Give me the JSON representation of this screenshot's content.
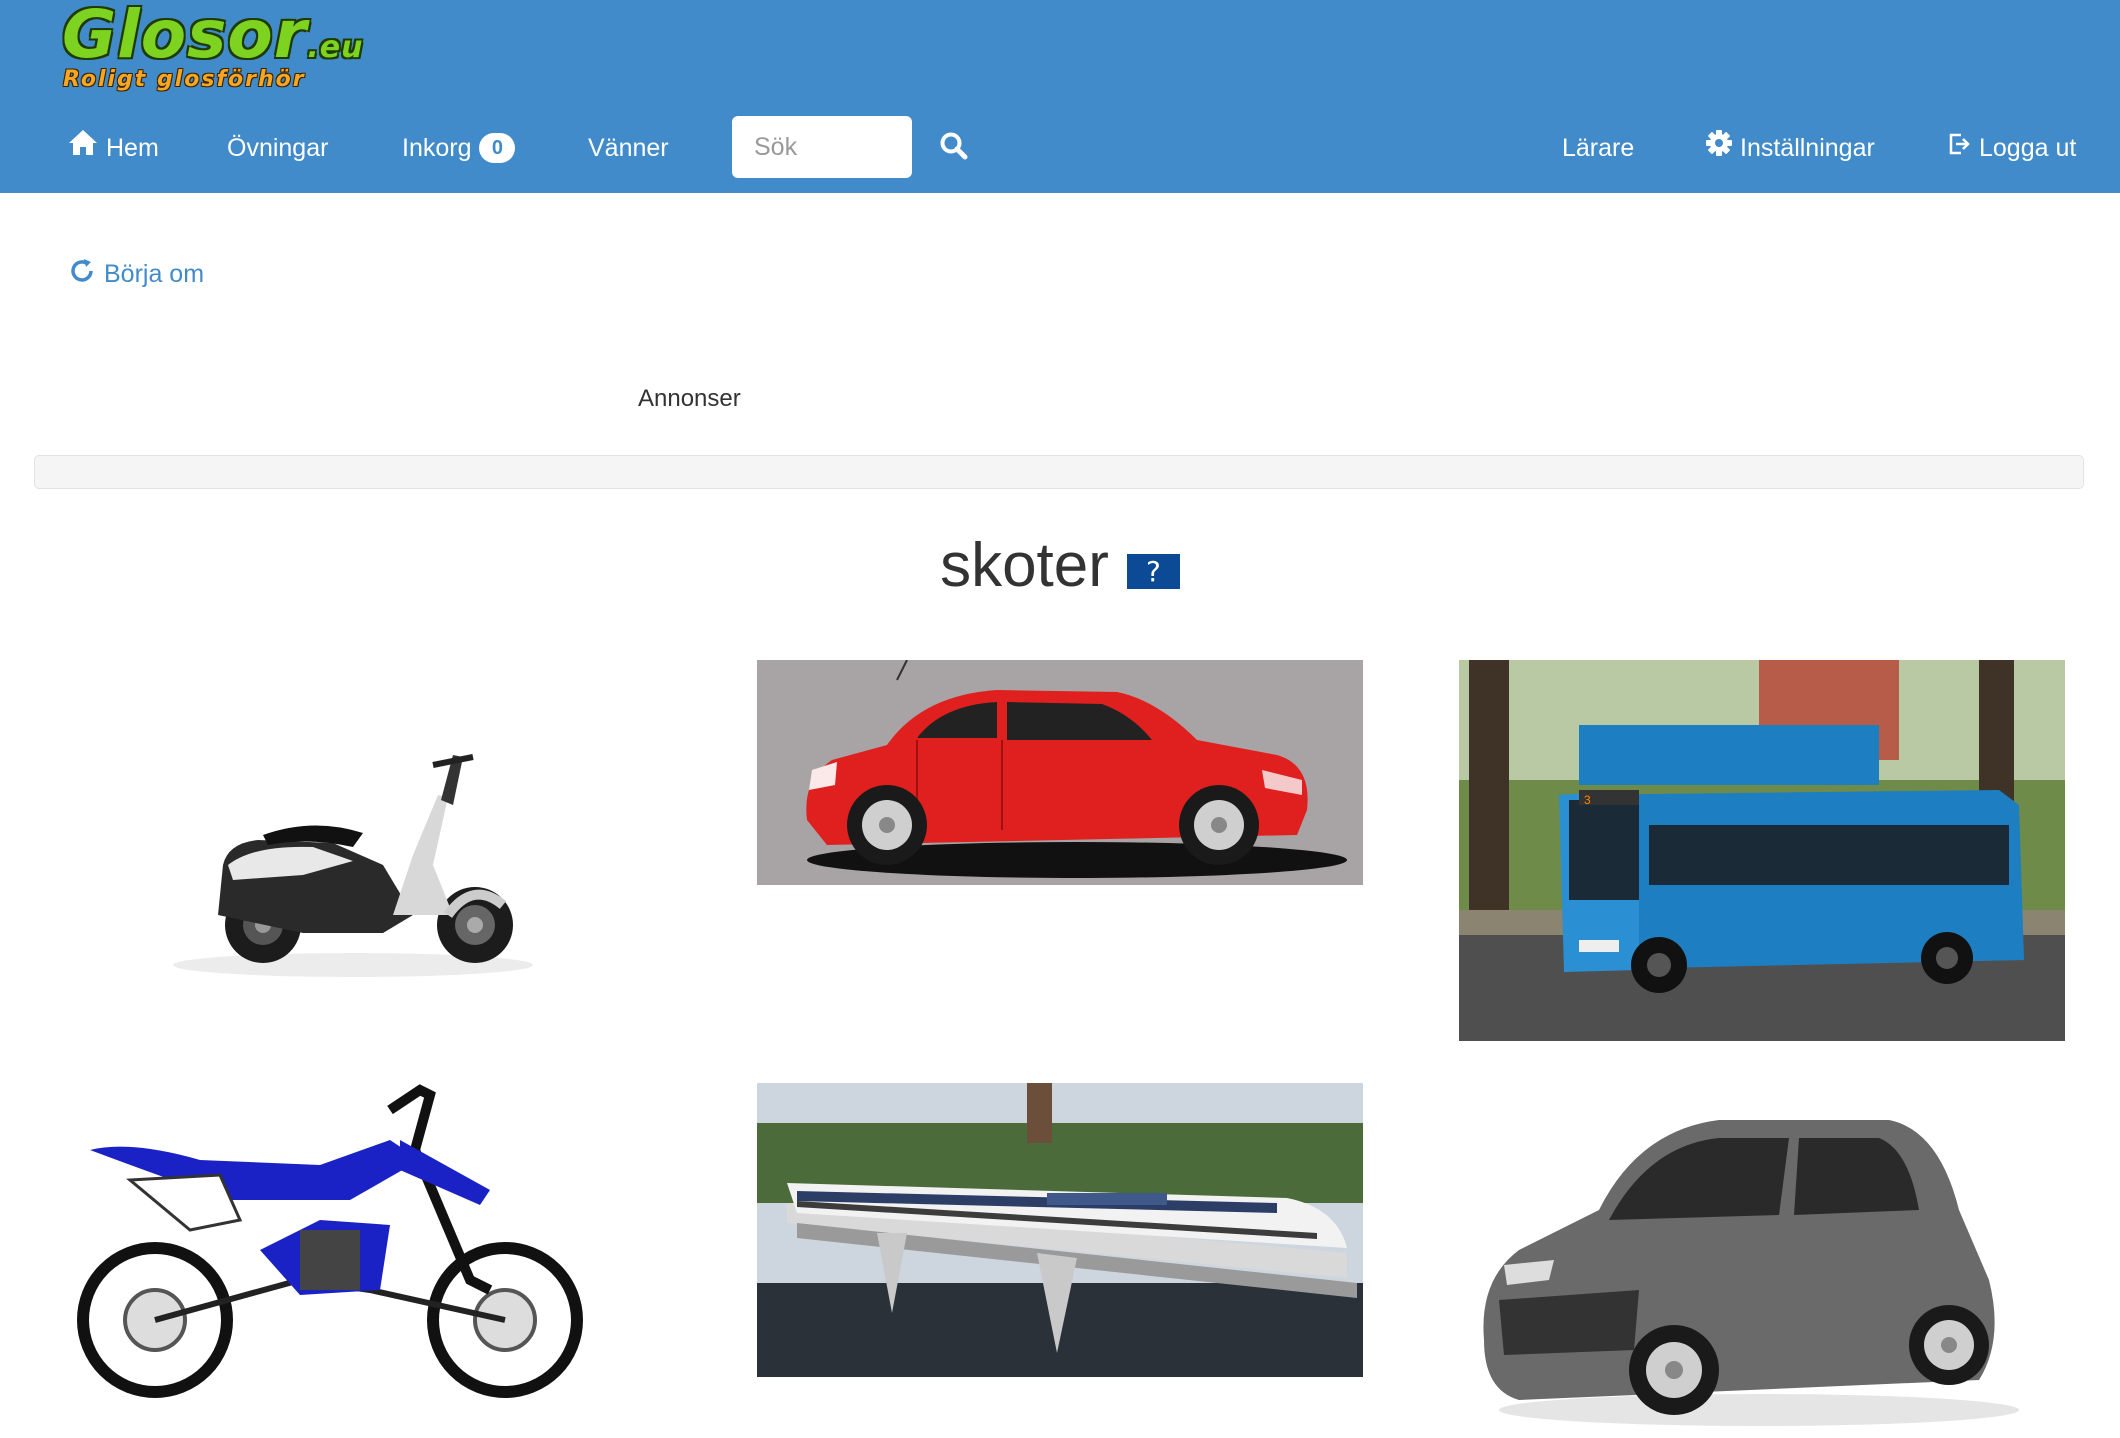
{
  "logo": {
    "main": "Glosor",
    "tld": ".eu",
    "tagline": "Roligt glosförhör"
  },
  "nav": {
    "home": "Hem",
    "exercises": "Övningar",
    "inbox": "Inkorg",
    "inbox_count": "0",
    "friends": "Vänner",
    "search_placeholder": "Sök",
    "teachers": "Lärare",
    "settings": "Inställningar",
    "logout": "Logga ut"
  },
  "restart_label": "Börja om",
  "ads_label": "Annonser",
  "quiz": {
    "word": "skoter",
    "help_label": "?",
    "options": [
      "scooter",
      "red hatchback car",
      "blue city bus",
      "blue motocross bike",
      "passenger train on bridge",
      "grey small car"
    ]
  },
  "colors": {
    "topbar": "#428bca",
    "link": "#428bca",
    "help_button": "#0d4a96"
  },
  "icons": [
    "home-icon",
    "search-icon",
    "refresh-icon",
    "gear-icon",
    "logout-icon"
  ]
}
